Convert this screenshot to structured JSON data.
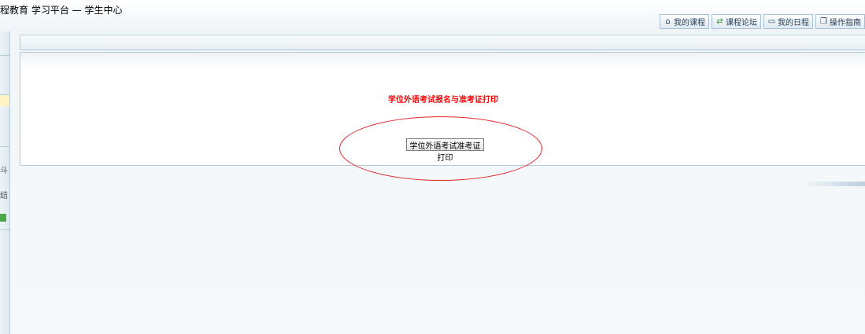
{
  "header": {
    "title": "程教育 学习平台 — 学生中心"
  },
  "toolbar": {
    "items": [
      {
        "label": "我的课程",
        "icon": "home-icon"
      },
      {
        "label": "课程论坛",
        "icon": "forum-icon"
      },
      {
        "label": "我的日程",
        "icon": "calendar-icon"
      },
      {
        "label": "操作指南",
        "icon": "guide-icon"
      }
    ]
  },
  "sidebar": {
    "items": [
      {
        "label": "斗"
      },
      {
        "label": "结"
      }
    ]
  },
  "main": {
    "heading": "学位外语考试报名与准考证打印",
    "print_button": "学位外语考试准考证打印"
  },
  "colors": {
    "heading": "#ff0000",
    "highlight": "#e0262b",
    "border": "#b7cad8"
  }
}
